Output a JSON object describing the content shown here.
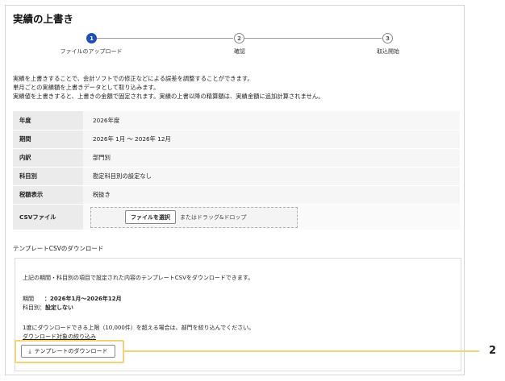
{
  "page": {
    "title": "実績の上書き"
  },
  "stepper": {
    "steps": [
      {
        "number": "1",
        "label": "ファイルのアップロード",
        "state": "active"
      },
      {
        "number": "2",
        "label": "確認",
        "state": "inactive"
      },
      {
        "number": "3",
        "label": "取込開始",
        "state": "inactive"
      }
    ]
  },
  "description": [
    "実績を上書きすることで、会計ソフトでの修正などによる誤差を調整することができます。",
    "単月ごとの実績額を上書きデータとして取り込みます。",
    "実績値を上書きすると、上書きの金額で固定されます。実績の上書以降の精算額は、実績金額に追加計算されません。"
  ],
  "settings": [
    {
      "label": "年度",
      "value": "2026年度"
    },
    {
      "label": "期間",
      "value": "2026年 1月 〜 2026年 12月"
    },
    {
      "label": "内訳",
      "value": "部門別"
    },
    {
      "label": "科目別",
      "value": "勘定科目別の設定なし"
    },
    {
      "label": "税額表示",
      "value": "税抜き"
    },
    {
      "label": "CSVファイル",
      "button": "ファイルを選択",
      "hint": "またはドラッグ&ドロップ"
    }
  ],
  "template": {
    "section_title": "テンプレートCSVのダウンロード",
    "intro": "上記の期間・科目別の項目で設定された内容のテンプレートCSVをダウンロードできます。",
    "period_key": "期間",
    "period_value": "：2026年1月〜2026年12月",
    "subject_key": "科目別：",
    "subject_value": "設定しない",
    "limit_note": "1度にダウンロードできる上限（10,000件）を超える場合は、部門を絞り込んでください。",
    "filter_link": "ダウンロード対象の絞り込み",
    "download_button": "テンプレートのダウンロード",
    "download_icon": "download-icon"
  },
  "callout": {
    "number": "2",
    "color": "#f0d47a"
  },
  "colors": {
    "accent": "#1e4fb8",
    "link": "#1f58c8"
  }
}
